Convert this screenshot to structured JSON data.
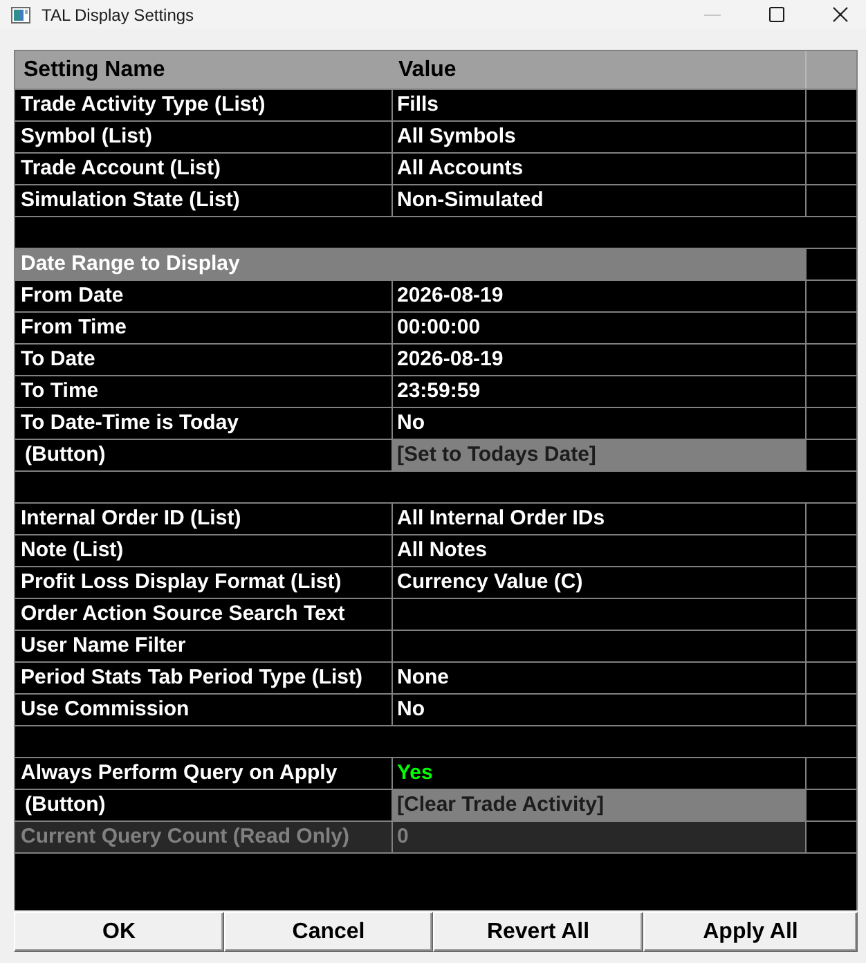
{
  "window": {
    "title": "TAL Display Settings"
  },
  "table": {
    "columns": [
      "Setting Name",
      "Value"
    ],
    "rows": [
      {
        "kind": "setting",
        "name": "Trade Activity Type (List)",
        "value": "Fills"
      },
      {
        "kind": "setting",
        "name": "Symbol (List)",
        "value": "All Symbols"
      },
      {
        "kind": "setting",
        "name": "Trade Account (List)",
        "value": "All Accounts"
      },
      {
        "kind": "setting",
        "name": "Simulation State (List)",
        "value": "Non-Simulated"
      },
      {
        "kind": "blank"
      },
      {
        "kind": "group",
        "name": "Date Range to Display"
      },
      {
        "kind": "setting",
        "name": "From Date",
        "value": "2026-08-19"
      },
      {
        "kind": "setting",
        "name": "From Time",
        "value": "00:00:00"
      },
      {
        "kind": "setting",
        "name": "To Date",
        "value": "2026-08-19"
      },
      {
        "kind": "setting",
        "name": "To Time",
        "value": "23:59:59"
      },
      {
        "kind": "setting",
        "name": "To Date-Time is Today",
        "value": "No"
      },
      {
        "kind": "button",
        "name": "(Button)",
        "value": "[Set to Todays Date]"
      },
      {
        "kind": "blank"
      },
      {
        "kind": "setting",
        "name": "Internal Order ID (List)",
        "value": "All Internal Order IDs"
      },
      {
        "kind": "setting",
        "name": "Note (List)",
        "value": "All Notes"
      },
      {
        "kind": "setting",
        "name": "Profit Loss Display Format (List)",
        "value": "Currency Value (C)"
      },
      {
        "kind": "setting",
        "name": "Order Action Source Search Text"
      },
      {
        "kind": "setting",
        "name": "User Name Filter"
      },
      {
        "kind": "setting",
        "name": "Period Stats Tab Period Type (List)",
        "value": "None"
      },
      {
        "kind": "setting",
        "name": "Use Commission",
        "value": "No"
      },
      {
        "kind": "blank"
      },
      {
        "kind": "setting",
        "name": "Always Perform Query on Apply",
        "value": "Yes",
        "color": "#00ff00"
      },
      {
        "kind": "button",
        "name": "(Button)",
        "value": "[Clear Trade Activity]"
      },
      {
        "kind": "readonly",
        "name": "Current Query Count (Read Only)",
        "value": "0"
      }
    ]
  },
  "buttons": [
    "OK",
    "Cancel",
    "Revert All",
    "Apply All"
  ]
}
